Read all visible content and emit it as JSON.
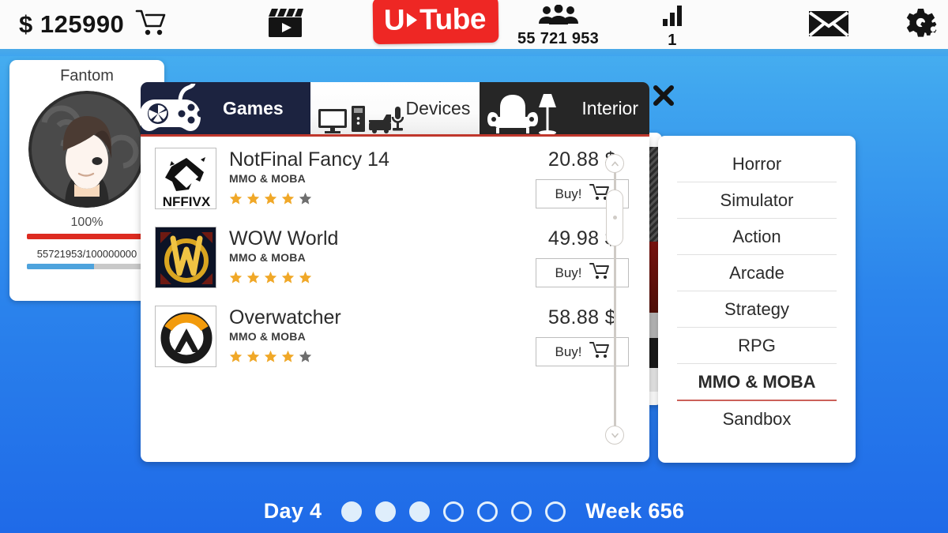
{
  "topbar": {
    "money": "$ 125990",
    "cart_icon": "shopping-cart-icon",
    "clapper_icon": "clapperboard-icon",
    "logo_u": "U",
    "logo_tube": "Tube",
    "subscribers": "55 721 953",
    "people_icon": "people-group-icon",
    "rank": "1",
    "bars_icon": "bar-chart-icon",
    "mail_icon": "envelope-icon",
    "gear_icon": "gear-icon"
  },
  "profile": {
    "name": "Fantom",
    "percent_label": "100%",
    "percent_value": 100,
    "ratio_label": "55721953/100000000",
    "ratio_value": 55.72,
    "bar_red_color": "#dd2b20",
    "bar_blue_color": "#4ea3dd"
  },
  "store": {
    "close_label": "×",
    "tabs": [
      {
        "label": "Games",
        "icon": "gamepad-icon",
        "selected": true
      },
      {
        "label": "Devices",
        "icon": "computer-devices-icon",
        "selected": false
      },
      {
        "label": "Interior",
        "icon": "armchair-lamp-icon",
        "selected": false
      }
    ],
    "items": [
      {
        "title": "NotFinal Fancy 14",
        "genre": "MMO & MOBA",
        "price": "20.88 $",
        "rating": 4,
        "max_rating": 5,
        "buy_label": "Buy!",
        "icon_name": "nffivx-logo-icon",
        "icon_caption": "NFFIVX"
      },
      {
        "title": "WOW World",
        "genre": "MMO & MOBA",
        "price": "49.98 $",
        "rating": 5,
        "max_rating": 5,
        "buy_label": "Buy!",
        "icon_name": "wow-world-logo-icon",
        "icon_caption": ""
      },
      {
        "title": "Overwatcher",
        "genre": "MMO & MOBA",
        "price": "58.88 $",
        "rating": 4,
        "max_rating": 5,
        "buy_label": "Buy!",
        "icon_name": "overwatcher-logo-icon",
        "icon_caption": ""
      }
    ],
    "scrollbar": {
      "up_icon": "chevron-up-icon",
      "down_icon": "chevron-down-icon",
      "thumb_position_pct": 7
    }
  },
  "categories": {
    "items": [
      {
        "label": "Horror",
        "selected": false
      },
      {
        "label": "Simulator",
        "selected": false
      },
      {
        "label": "Action",
        "selected": false
      },
      {
        "label": "Arcade",
        "selected": false
      },
      {
        "label": "Strategy",
        "selected": false
      },
      {
        "label": "RPG",
        "selected": false
      },
      {
        "label": "MMO & MOBA",
        "selected": true
      },
      {
        "label": "Sandbox",
        "selected": false
      }
    ]
  },
  "bottombar": {
    "day_label": "Day 4",
    "week_label": "Week 656",
    "days_filled": 3,
    "days_total": 7
  },
  "colors": {
    "accent_red": "#ee2724",
    "tab_games_bg": "#1c2340",
    "tab_interior_bg": "#262626",
    "star_gold": "#f0a828",
    "star_gray": "#6e6e6e",
    "background_top": "#4db7f0",
    "background_bottom": "#1f6ae8"
  }
}
